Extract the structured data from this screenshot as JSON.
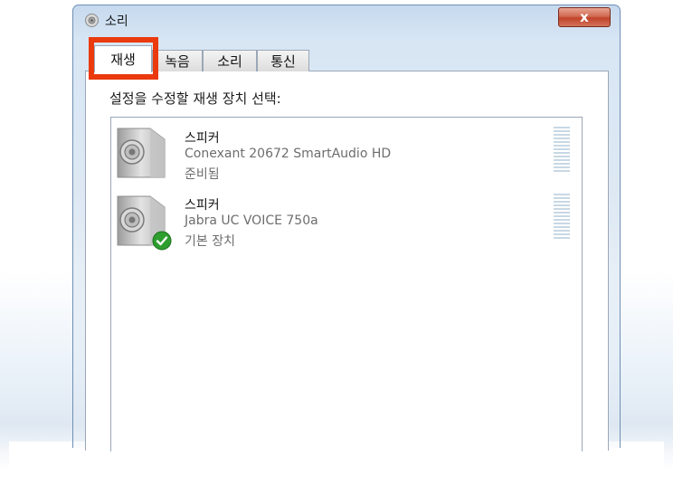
{
  "window": {
    "title": "소리",
    "close_label": "x"
  },
  "tabs": [
    {
      "label": "재생",
      "selected": true
    },
    {
      "label": "녹음",
      "selected": false
    },
    {
      "label": "소리",
      "selected": false
    },
    {
      "label": "통신",
      "selected": false
    }
  ],
  "instruction": "설정을 수정할 재생 장치 선택:",
  "devices": [
    {
      "name": "스피커",
      "description": "Conexant 20672 SmartAudio HD",
      "status": "준비됨",
      "icon": "speaker-icon",
      "is_default": false
    },
    {
      "name": "스피커",
      "description": "Jabra UC VOICE 750a",
      "status": "기본 장치",
      "icon": "speaker-icon",
      "is_default": true,
      "badge_icon": "default-check-icon"
    }
  ],
  "colors": {
    "highlight": "#ea3a0e",
    "default_check": "#2e9e2e",
    "meter": "#c8d8e4"
  }
}
